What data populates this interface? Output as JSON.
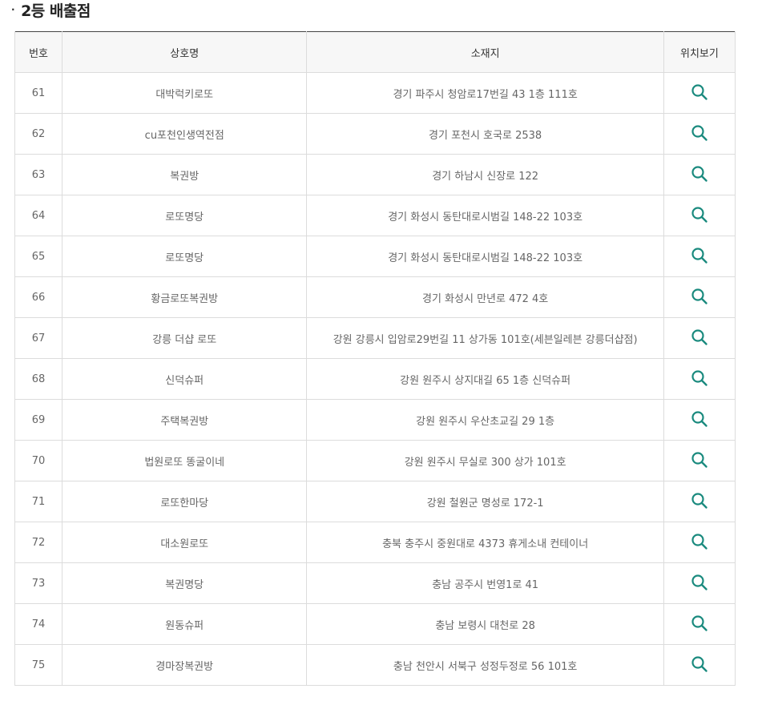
{
  "section": {
    "bullet": "·",
    "title": "2등 배출점"
  },
  "table": {
    "headers": {
      "no": "번호",
      "name": "상호명",
      "address": "소재지",
      "map": "위치보기"
    },
    "rows": [
      {
        "no": "61",
        "name": "대박럭키로또",
        "address": "경기 파주시 청암로17번길 43 1층 111호",
        "map_icon": "search-icon"
      },
      {
        "no": "62",
        "name": "cu포천인생역전점",
        "address": "경기 포천시 호국로 2538",
        "map_icon": "search-icon"
      },
      {
        "no": "63",
        "name": "복권방",
        "address": "경기 하남시 신장로 122",
        "map_icon": "search-icon"
      },
      {
        "no": "64",
        "name": "로또명당",
        "address": "경기 화성시 동탄대로시범길 148-22 103호",
        "map_icon": "search-icon"
      },
      {
        "no": "65",
        "name": "로또명당",
        "address": "경기 화성시 동탄대로시범길 148-22 103호",
        "map_icon": "search-icon"
      },
      {
        "no": "66",
        "name": "황금로또복권방",
        "address": "경기 화성시 만년로 472 4호",
        "map_icon": "search-icon"
      },
      {
        "no": "67",
        "name": "강릉 더샵 로또",
        "address": "강원 강릉시 입암로29번길 11 상가동 101호(세븐일레븐 강릉더샵점)",
        "map_icon": "search-icon"
      },
      {
        "no": "68",
        "name": "신덕슈퍼",
        "address": "강원 원주시 상지대길 65 1층 신덕슈퍼",
        "map_icon": "search-icon"
      },
      {
        "no": "69",
        "name": "주택복권방",
        "address": "강원 원주시 우산초교길 29 1층",
        "map_icon": "search-icon"
      },
      {
        "no": "70",
        "name": "법원로또 똥굴이네",
        "address": "강원 원주시 무실로 300 상가 101호",
        "map_icon": "search-icon"
      },
      {
        "no": "71",
        "name": "로또한마당",
        "address": "강원 철원군 명성로 172-1",
        "map_icon": "search-icon"
      },
      {
        "no": "72",
        "name": "대소원로또",
        "address": "충북 충주시 중원대로 4373 휴게소내 컨테이너",
        "map_icon": "search-icon"
      },
      {
        "no": "73",
        "name": "복권명당",
        "address": "충남 공주시 번영1로 41",
        "map_icon": "search-icon"
      },
      {
        "no": "74",
        "name": "원동슈퍼",
        "address": "충남 보령시 대천로 28",
        "map_icon": "search-icon"
      },
      {
        "no": "75",
        "name": "경마장복권방",
        "address": "충남 천안시 서북구 성정두정로 56 101호",
        "map_icon": "search-icon"
      }
    ]
  },
  "colors": {
    "accent_icon": "#1a8a7e",
    "header_bg": "#f7f7f7",
    "border": "#dcdcdc",
    "top_border": "#444444"
  }
}
